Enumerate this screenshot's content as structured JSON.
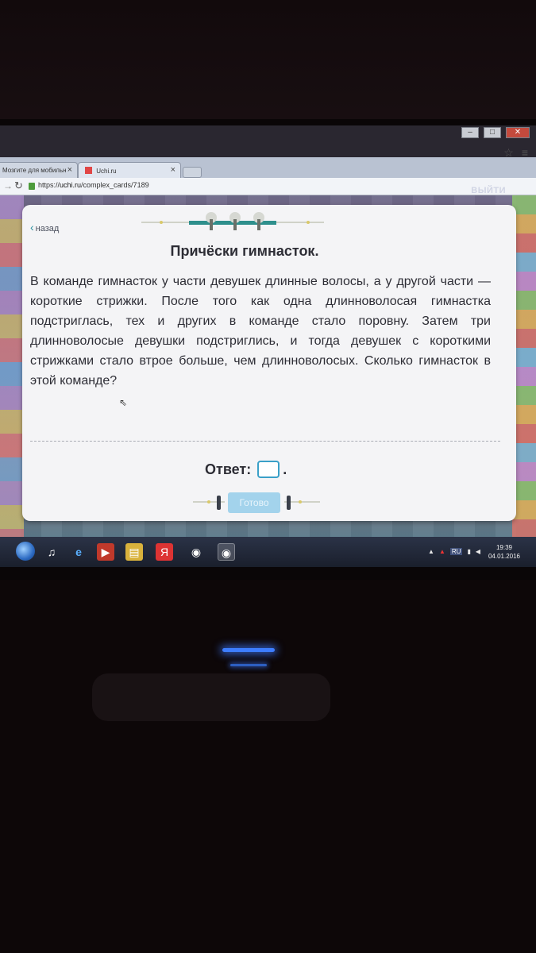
{
  "browser": {
    "tabs": [
      {
        "label": "Мозгите для мобильн"
      },
      {
        "label": "Uchi.ru"
      }
    ],
    "url": {
      "protocol": "https://",
      "host": "uchi.ru",
      "path": "/complex_cards/7189"
    }
  },
  "page": {
    "logout_label": "ВЫЙТИ",
    "back_label": "назад",
    "title": "Причёски гимнасток.",
    "problem_text": "В команде гимнасток у части девушек длинные волосы, а у другой части — короткие стрижки. После того как одна длинноволосая гимнастка подстриглась, тех и других в команде стало поровну. Затем три длинноволосые девушки подстриглись, и тогда девушек с короткими стрижками стало втрое больше, чем длинноволосых. Сколько гимнасток в этой команде?",
    "answer_label": "Ответ:",
    "answer_value": "",
    "answer_suffix": ".",
    "done_label": "Готово"
  },
  "taskbar": {
    "lang": "RU",
    "time": "19:39",
    "date": "04.01.2016"
  },
  "colors": {
    "accent": "#3aa0c8",
    "done_button": "#a3d3ec",
    "card": "#f4f4f6"
  }
}
